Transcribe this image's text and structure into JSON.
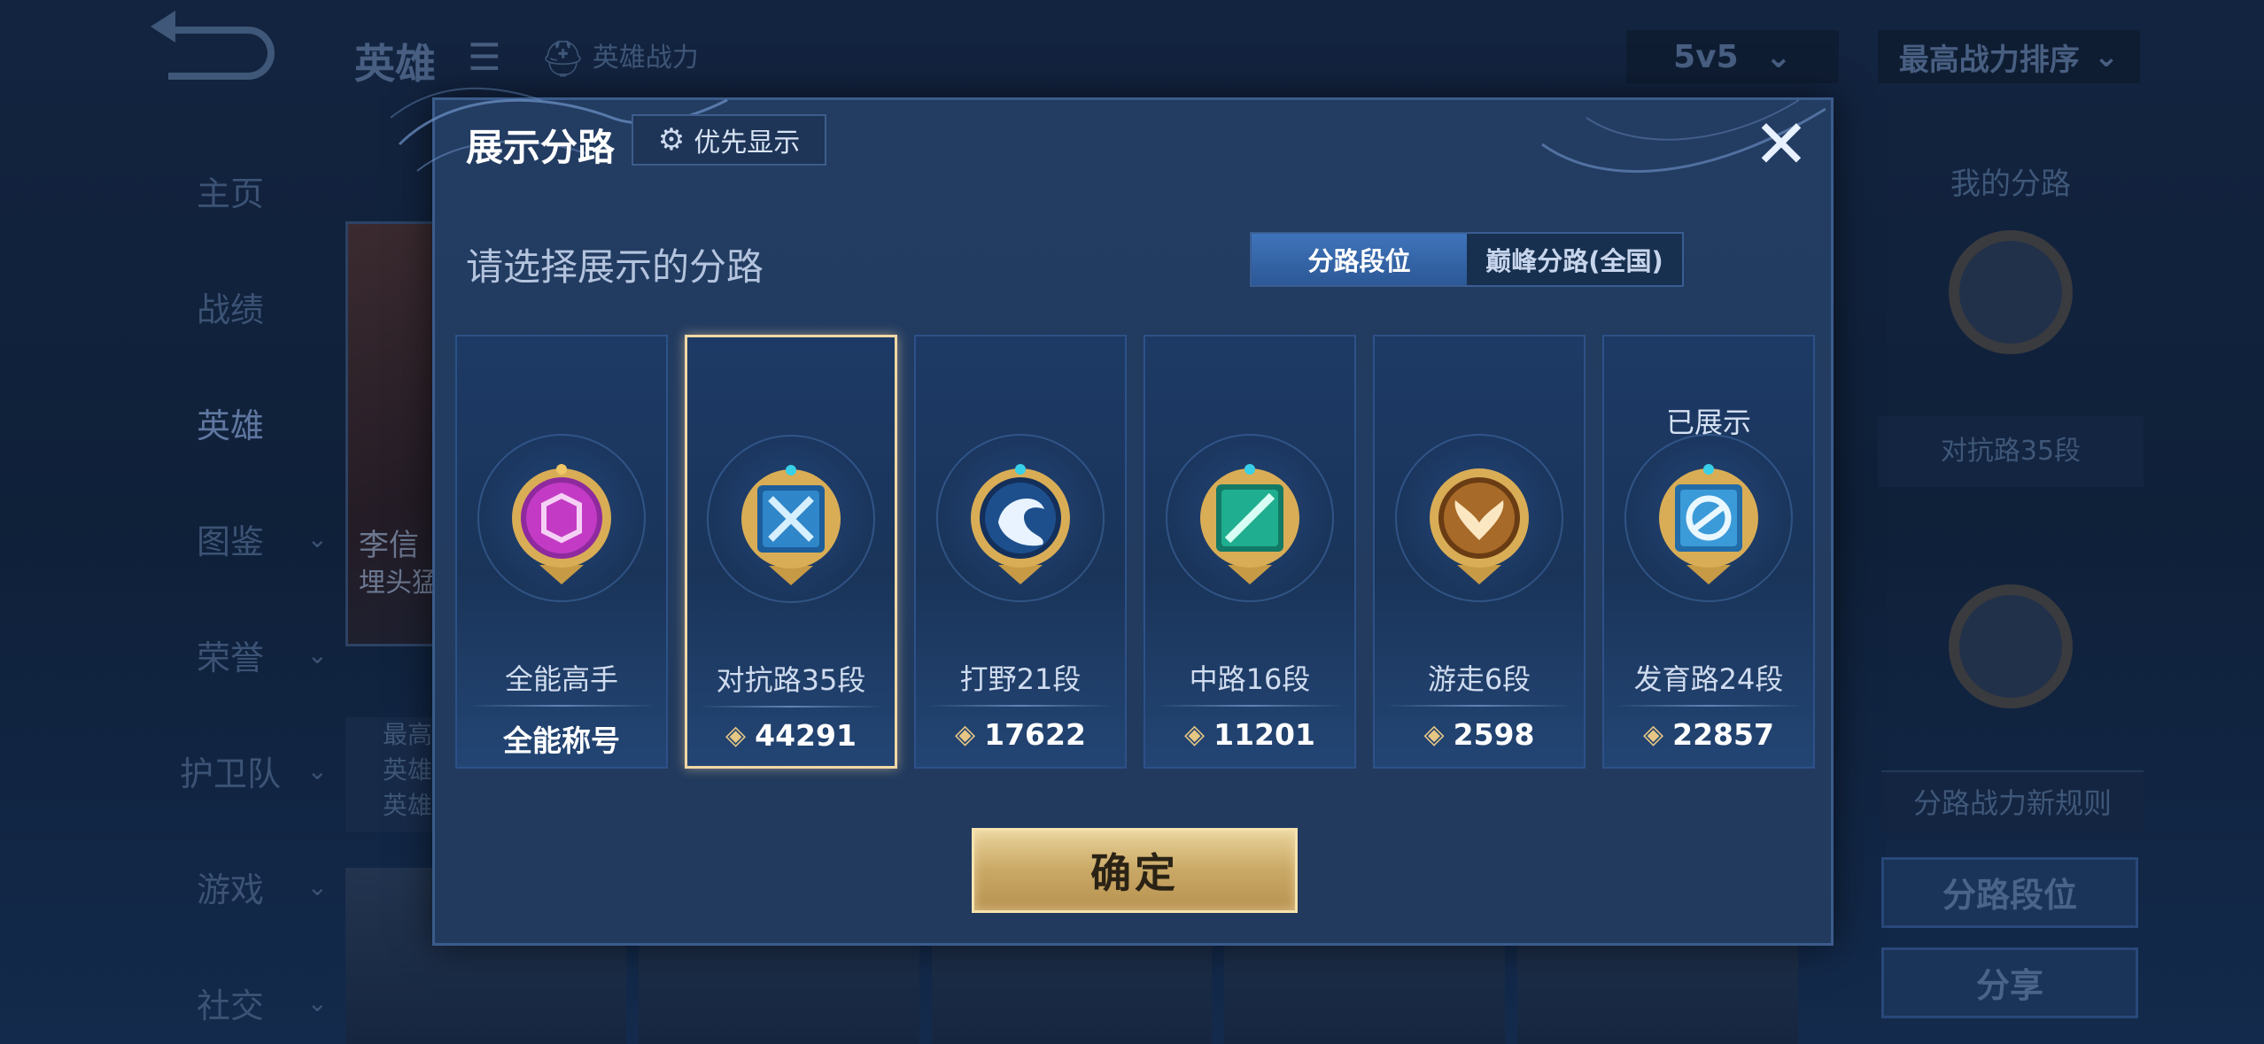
{
  "background": {
    "title": "英雄",
    "hero_power_label": "英雄战力",
    "mode": "5v5",
    "sort": "最高战力排序",
    "sidebar": [
      {
        "label": "主页",
        "active": false,
        "chevron": false
      },
      {
        "label": "战绩",
        "active": false,
        "chevron": false
      },
      {
        "label": "英雄",
        "active": true,
        "chevron": false
      },
      {
        "label": "图鉴",
        "active": false,
        "chevron": true
      },
      {
        "label": "荣誉",
        "active": false,
        "chevron": true
      },
      {
        "label": "护卫队",
        "active": false,
        "chevron": true
      },
      {
        "label": "游戏",
        "active": false,
        "chevron": true
      },
      {
        "label": "社交",
        "active": false,
        "chevron": true
      }
    ],
    "hero_card": {
      "name": "李信",
      "title": "埋头猛"
    },
    "stats_lines": [
      "最高",
      "英雄",
      "英雄"
    ],
    "right_panel": {
      "title": "我的分路",
      "lane_label": "对抗路35段",
      "rules": "分路战力新规则",
      "lane_rank_button": "分路段位",
      "share_button": "分享"
    }
  },
  "modal": {
    "title": "展示分路",
    "priority_button": "优先显示",
    "subtitle": "请选择展示的分路",
    "tabs": [
      {
        "label": "分路段位",
        "active": true
      },
      {
        "label": "巅峰分路(全国)",
        "active": false
      }
    ],
    "cards": [
      {
        "role": "全能高手",
        "score": "全能称号",
        "shown": "",
        "selected": false,
        "badge_color": "#c33bc4",
        "badge_icon": "all-round-icon",
        "has_power_icon": false
      },
      {
        "role": "对抗路35段",
        "score": "44291",
        "shown": "",
        "selected": true,
        "badge_color": "#2f86c9",
        "badge_icon": "crossed-swords-icon",
        "has_power_icon": true
      },
      {
        "role": "打野21段",
        "score": "17622",
        "shown": "",
        "selected": false,
        "badge_color": "#1e4f8d",
        "badge_icon": "dragon-icon",
        "has_power_icon": true
      },
      {
        "role": "中路16段",
        "score": "11201",
        "shown": "",
        "selected": false,
        "badge_color": "#1fae8f",
        "badge_icon": "staff-icon",
        "has_power_icon": true
      },
      {
        "role": "游走6段",
        "score": "2598",
        "shown": "",
        "selected": false,
        "badge_color": "#a86a28",
        "badge_icon": "wings-icon",
        "has_power_icon": true
      },
      {
        "role": "发育路24段",
        "score": "22857",
        "shown": "已展示",
        "selected": false,
        "badge_color": "#3b9ad8",
        "badge_icon": "bow-icon",
        "has_power_icon": true
      }
    ],
    "confirm_button": "确定",
    "close_icon": "close-icon"
  }
}
